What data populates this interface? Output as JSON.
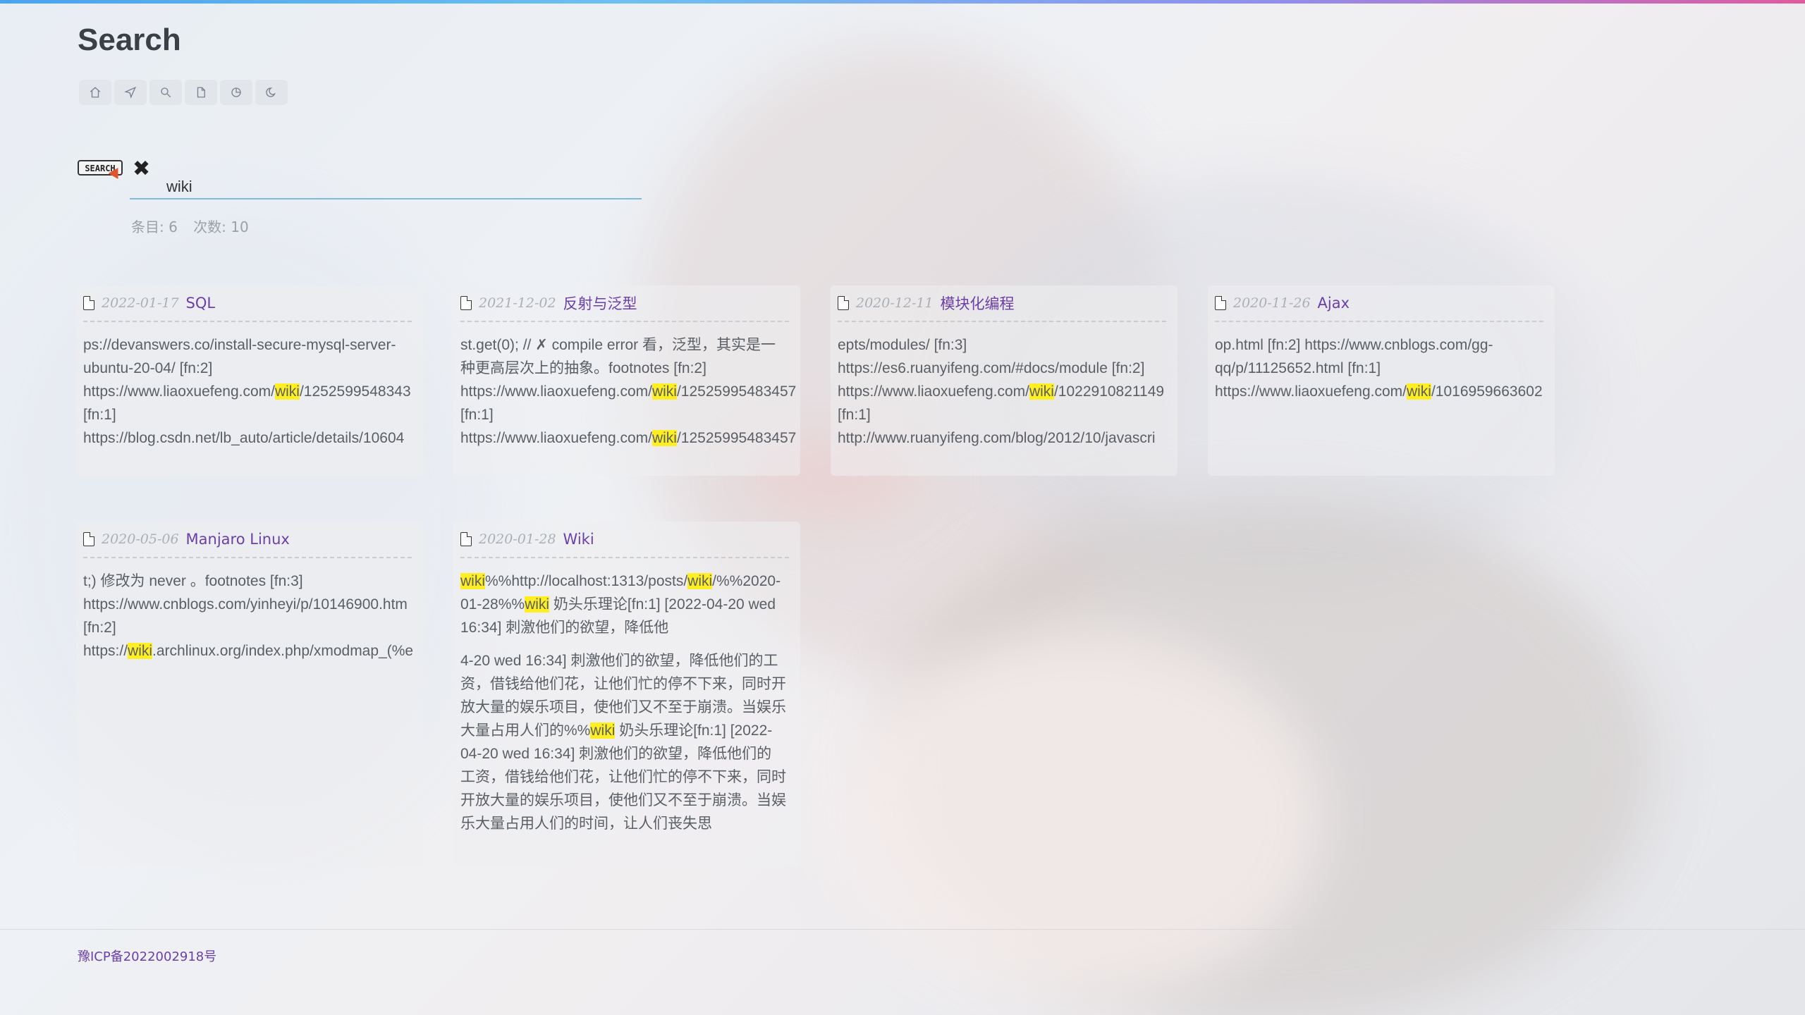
{
  "page": {
    "title": "Search"
  },
  "nav": [
    {
      "name": "home-icon"
    },
    {
      "name": "send-icon"
    },
    {
      "name": "search-icon"
    },
    {
      "name": "file-icon"
    },
    {
      "name": "chart-icon"
    },
    {
      "name": "moon-icon"
    }
  ],
  "search": {
    "badge": "SEARCH",
    "clear": "✖",
    "query": "wiki"
  },
  "stats": {
    "items": "条目: 6",
    "hits": "次数: 10"
  },
  "results": [
    {
      "date": "2022-01-17",
      "title": "SQL",
      "snippets": [
        [
          "ps://devanswers.co/install-secure-mysql-server-\nubuntu-20-04/ [fn:2]\nhttps://www.liaoxuefeng.com/",
          "wiki",
          "/1252599548343\n[fn:1]\nhttps://blog.csdn.net/lb_auto/article/details/10604"
        ]
      ]
    },
    {
      "date": "2021-12-02",
      "title": "反射与泛型",
      "snippets": [
        [
          "st.get(0); // ✗ compile error 看，泛型，其实是一\n种更高层次上的抽象。footnotes [fn:2]\nhttps://www.liaoxuefeng.com/",
          "wiki",
          "/12525995483457\n[fn:1]\nhttps://www.liaoxuefeng.com/",
          "wiki",
          "/12525995483457"
        ]
      ]
    },
    {
      "date": "2020-12-11",
      "title": "模块化编程",
      "snippets": [
        [
          "epts/modules/ [fn:3]\nhttps://es6.ruanyifeng.com/#docs/module [fn:2]\nhttps://www.liaoxuefeng.com/",
          "wiki",
          "/1022910821149\n[fn:1]\nhttp://www.ruanyifeng.com/blog/2012/10/javascri"
        ]
      ]
    },
    {
      "date": "2020-11-26",
      "title": "Ajax",
      "snippets": [
        [
          "op.html [fn:2] https://www.cnblogs.com/gg-\nqq/p/11125652.html [fn:1]\nhttps://www.liaoxuefeng.com/",
          "wiki",
          "/1016959663602"
        ]
      ]
    },
    {
      "date": "2020-05-06",
      "title": "Manjaro Linux",
      "snippets": [
        [
          "t;) 修改为 never 。footnotes [fn:3]\nhttps://www.cnblogs.com/yinheyi/p/10146900.htm\n[fn:2]\nhttps://",
          "wiki",
          ".archlinux.org/index.php/xmodmap_(%e"
        ]
      ]
    },
    {
      "date": "2020-01-28",
      "title": "Wiki",
      "snippets": [
        [
          "",
          "wiki",
          "%%http://localhost:1313/posts/",
          "wiki",
          "/%%2020-\n01-28%%",
          "wiki",
          " 奶头乐理论[fn:1] [2022-04-20 wed\n16:34] 刺激他们的欲望，降低他"
        ],
        [
          "4-20 wed 16:34] 刺激他们的欲望，降低他们的工\n资，借钱给他们花，让他们忙的停不下来，同时开\n放大量的娱乐项目，使他们又不至于崩溃。当娱乐\n大量占用人们的%%",
          "wiki",
          " 奶头乐理论[fn:1] [2022-\n04-20 wed 16:34] 刺激他们的欲望，降低他们的\n工资，借钱给他们花，让他们忙的停不下来，同时\n开放大量的娱乐项目，使他们又不至于崩溃。当娱\n乐大量占用人们的时间，让人们丧失思"
        ]
      ]
    }
  ],
  "footer": {
    "icp": "豫ICP备2022002918号"
  },
  "colors": {
    "accent": "#6a3fa8",
    "highlight": "#ffef22",
    "input_underline": "#7eb9de"
  }
}
